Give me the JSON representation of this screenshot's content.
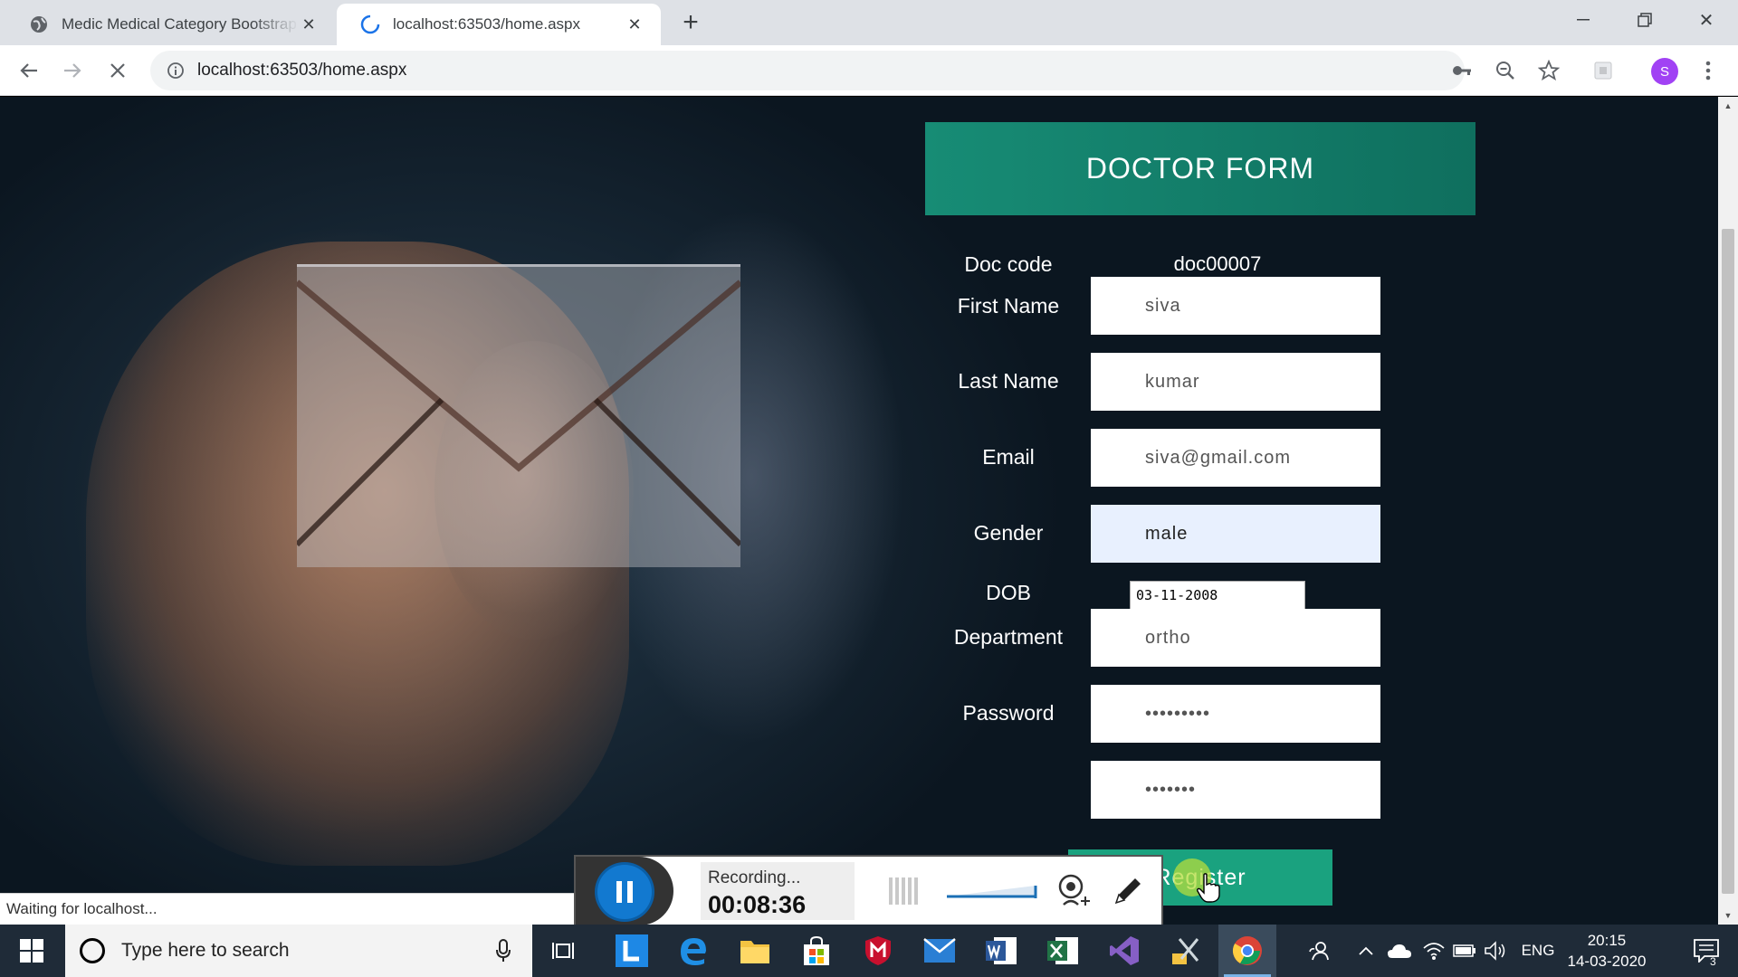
{
  "browser": {
    "tabs": [
      {
        "title": "Medic Medical Category Bootstrap",
        "icon": "globe-icon"
      },
      {
        "title": "localhost:63503/home.aspx",
        "icon": "loading-spinner-icon"
      }
    ],
    "url": "localhost:63503/home.aspx",
    "profile_initial": "S",
    "status_text": "Waiting for localhost..."
  },
  "form": {
    "title": "DOCTOR FORM",
    "doc_code_label": "Doc code",
    "doc_code_value": "doc00007",
    "first_name_label": "First Name",
    "first_name_value": "siva",
    "last_name_label": "Last Name",
    "last_name_value": "kumar",
    "email_label": "Email",
    "email_value": "siva@gmail.com",
    "gender_label": "Gender",
    "gender_value": "male",
    "dob_label": "DOB",
    "dob_value": "03-11-2008",
    "department_label": "Department",
    "department_value": "ortho",
    "password_label": "Password",
    "password_value": "•••••••••",
    "confirm_password_value": "•••••••",
    "register_label": "Register"
  },
  "recorder": {
    "status": "Recording...",
    "elapsed": "00:08:36"
  },
  "taskbar": {
    "search_placeholder": "Type here to search",
    "language": "ENG",
    "time": "20:15",
    "date": "14-03-2020",
    "notification_count": "3"
  },
  "colors": {
    "form_header": "#178c75",
    "register_button": "#1aa27f",
    "taskbar": "#1f2b38",
    "recorder_pause": "#1279d0"
  }
}
